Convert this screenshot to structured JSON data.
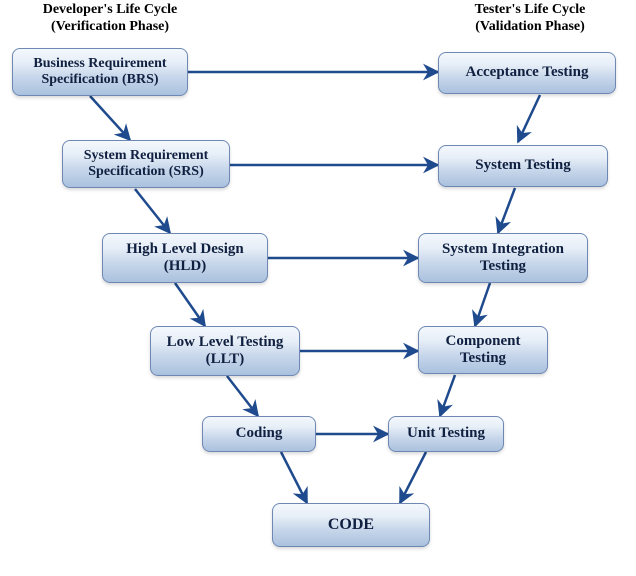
{
  "headers": {
    "left": {
      "line1": "Developer's Life Cycle",
      "line2": "(Verification Phase)"
    },
    "right": {
      "line1": "Tester's Life Cycle",
      "line2": "(Validation Phase)"
    }
  },
  "left_nodes": {
    "brs": "Business Requirement\nSpecification (BRS)",
    "srs": "System Requirement\nSpecification (SRS)",
    "hld": "High Level Design\n(HLD)",
    "llt": "Low Level Testing\n(LLT)",
    "coding": "Coding"
  },
  "right_nodes": {
    "acceptance": "Acceptance Testing",
    "system": "System Testing",
    "sit": "System Integration\nTesting",
    "component": "Component\nTesting",
    "unit": "Unit Testing"
  },
  "bottom_node": "CODE",
  "arrow_color": "#1f4b8e",
  "relations": [
    [
      "brs",
      "acceptance"
    ],
    [
      "srs",
      "system"
    ],
    [
      "hld",
      "sit"
    ],
    [
      "llt",
      "component"
    ],
    [
      "coding",
      "unit"
    ],
    [
      "brs",
      "srs"
    ],
    [
      "srs",
      "hld"
    ],
    [
      "hld",
      "llt"
    ],
    [
      "llt",
      "coding"
    ],
    [
      "coding",
      "code"
    ],
    [
      "acceptance",
      "system"
    ],
    [
      "system",
      "sit"
    ],
    [
      "sit",
      "component"
    ],
    [
      "component",
      "unit"
    ],
    [
      "unit",
      "code"
    ]
  ]
}
